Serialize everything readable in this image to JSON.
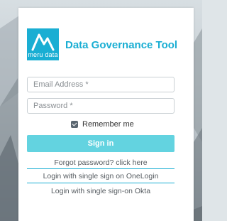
{
  "brand": {
    "logo_text": "meru data",
    "app_title": "Data Governance Tool",
    "accent_color": "#1aaed3"
  },
  "login_form": {
    "email_placeholder": "Email Address *",
    "password_placeholder": "Password *",
    "remember_label": "Remember me",
    "remember_checked": true,
    "signin_label": "Sign in",
    "forgot_link": "Forgot password? click here",
    "onelogin_link": "Login with single sign on OneLogin",
    "okta_link": "Login with single sign-on Okta",
    "button_color": "#63d3e0"
  },
  "icons": {
    "logo": "mountain-m-logo-icon",
    "checkbox": "checkmark-icon"
  }
}
